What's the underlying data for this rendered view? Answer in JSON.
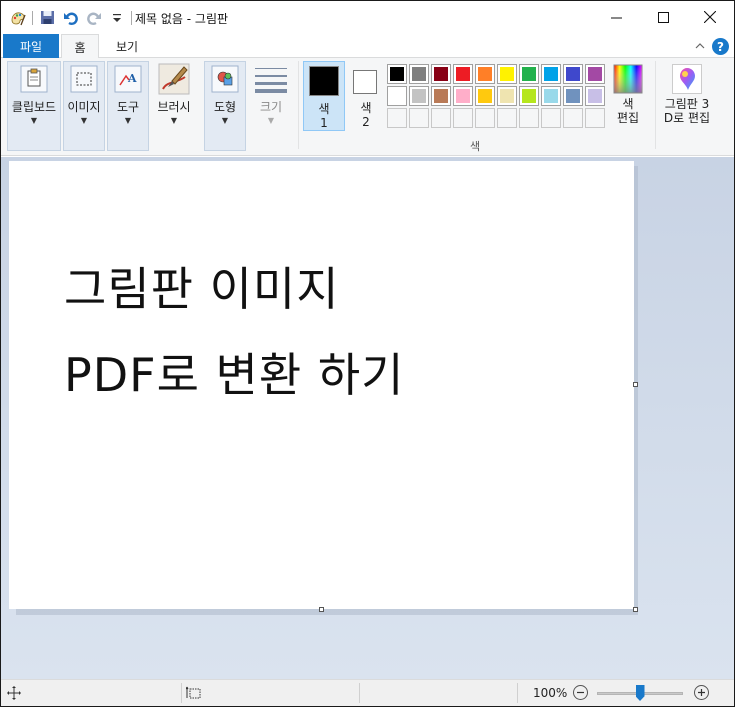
{
  "window": {
    "title": "제목 없음 - 그림판"
  },
  "tabs": {
    "file": "파일",
    "home": "홈",
    "view": "보기",
    "help": "?"
  },
  "ribbon": {
    "clipboard": "클립보드",
    "image": "이미지",
    "tools": "도구",
    "brushes": "브러시",
    "shapes": "도형",
    "size": "크기",
    "color1_a": "색",
    "color1_b": "1",
    "color2_a": "색",
    "color2_b": "2",
    "edit_colors_a": "색",
    "edit_colors_b": "편집",
    "paint3d_a": "그림판 3",
    "paint3d_b": "D로 편집",
    "colors_group_caption": "색",
    "color1_value": "#000000",
    "color2_value": "#ffffff",
    "palette_row1": [
      "#000000",
      "#7f7f7f",
      "#880015",
      "#ed1c24",
      "#ff7f27",
      "#fff200",
      "#22b14c",
      "#00a2e8",
      "#3f48cc",
      "#a349a4"
    ],
    "palette_row2": [
      "#ffffff",
      "#c3c3c3",
      "#b97a57",
      "#ffaec9",
      "#ffc90e",
      "#efe4b0",
      "#b5e61d",
      "#99d9ea",
      "#7092be",
      "#c8bfe7"
    ]
  },
  "canvas": {
    "line1": "그림판 이미지",
    "line2": "PDF로 변환 하기"
  },
  "statusbar": {
    "zoom": "100%",
    "zoom_level": 0.5
  }
}
